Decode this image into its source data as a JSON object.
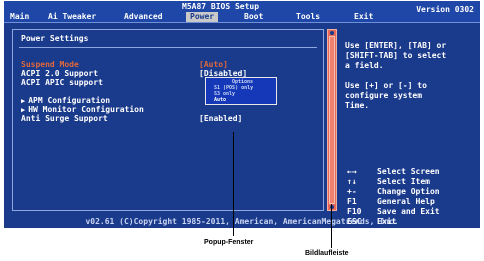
{
  "bios": {
    "setup_title": "M5A87 BIOS Setup",
    "version": "Version 0302",
    "menu": [
      {
        "label": "Main"
      },
      {
        "label": "Ai Tweaker"
      },
      {
        "label": "Advanced"
      },
      {
        "label": "Power"
      },
      {
        "label": "Boot"
      },
      {
        "label": "Tools"
      },
      {
        "label": "Exit"
      }
    ],
    "active_menu": "Power",
    "panel_title": "Power Settings",
    "settings": [
      {
        "label": "Suspend Mode",
        "value": "[Auto]"
      },
      {
        "label": "ACPI 2.0 Support",
        "value": "[Disabled]"
      },
      {
        "label": "ACPI APIC support",
        "value": ""
      },
      {
        "label": "APM Configuration",
        "value": ""
      },
      {
        "label": "HW Monitor Configuration",
        "value": ""
      },
      {
        "label": "Anti Surge Support",
        "value": "[Enabled]"
      }
    ],
    "popup": {
      "title": "Options",
      "options": [
        "S1 (POS) only",
        "S3 only",
        "Auto"
      ],
      "selected": "Auto"
    },
    "help": {
      "lines": [
        "Use [ENTER], [TAB] or",
        "[SHIFT-TAB] to select",
        "a field.",
        "",
        "Use [+] or [-] to",
        "configure system",
        "Time."
      ],
      "keys": [
        {
          "key": "←→",
          "desc": "Select Screen"
        },
        {
          "key": "↑↓",
          "desc": "Select Item"
        },
        {
          "key": "+-",
          "desc": "Change Option"
        },
        {
          "key": "F1",
          "desc": "General Help"
        },
        {
          "key": "F10",
          "desc": "Save and Exit"
        },
        {
          "key": "ESC",
          "desc": "Exit"
        }
      ]
    },
    "footer": "v02.61 (C)Copyright 1985-2011, American, AmericanMegatrends, Inc."
  },
  "callouts": {
    "popup_label": "Popup-Fenster",
    "scrollbar_label": "Bildlaufleiste"
  },
  "colors": {
    "background": "#1a3a8c",
    "highlight": "#e0683a",
    "scrollbar": "#e6685a",
    "text": "#ffffff"
  }
}
